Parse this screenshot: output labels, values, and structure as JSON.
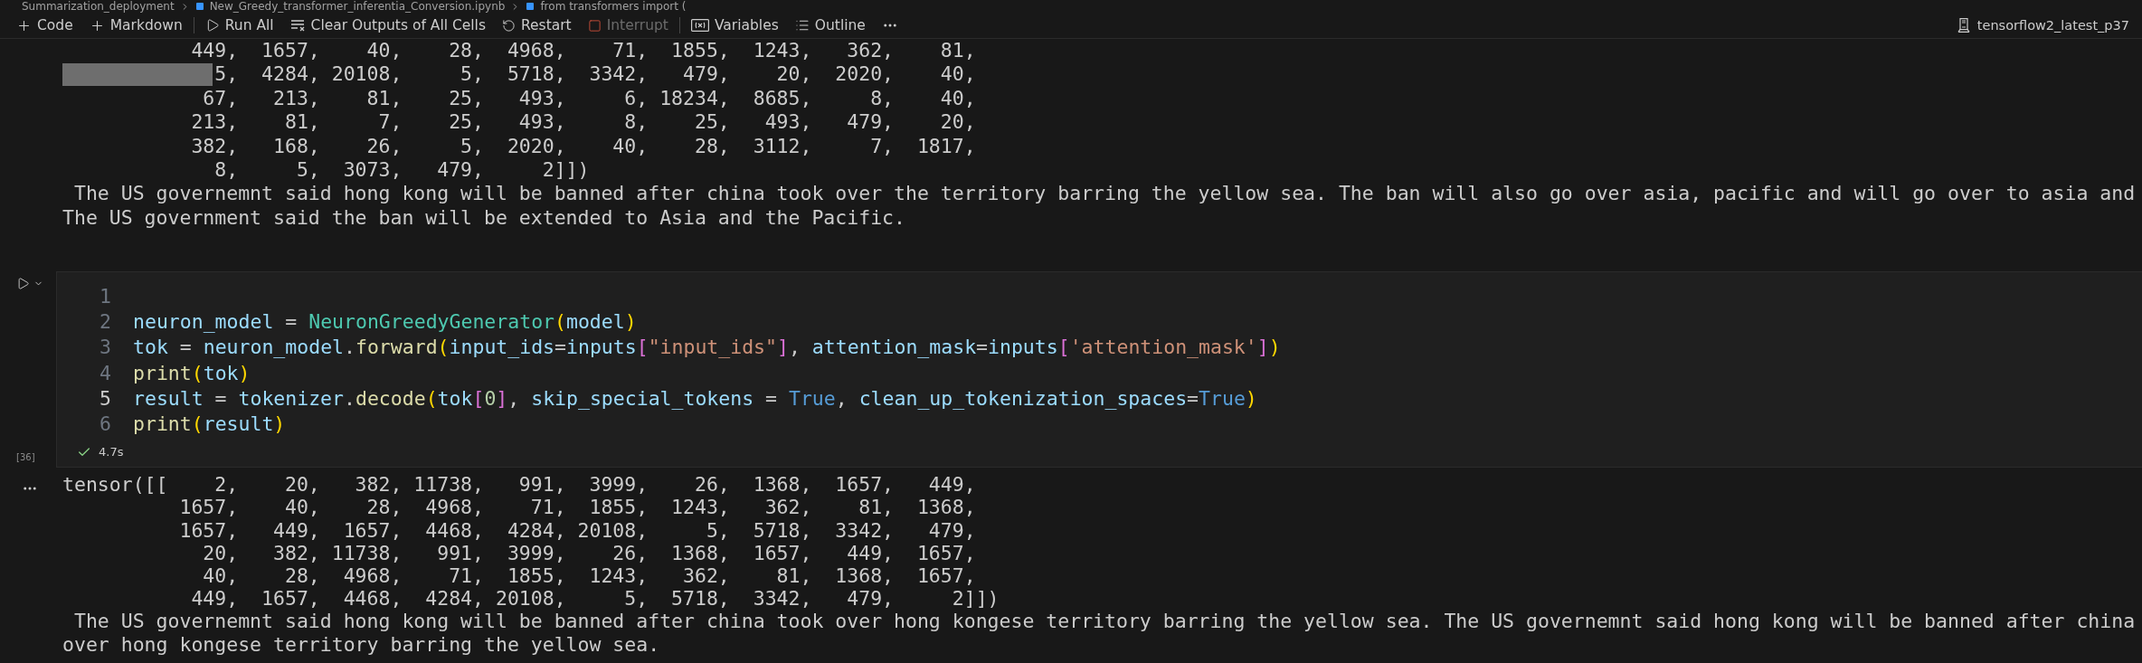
{
  "breadcrumb": [
    {
      "label": "Summarization_deployment",
      "kind": "folder"
    },
    {
      "label": "New_Greedy_transformer_inferentia_Conversion.ipynb",
      "kind": "notebook"
    },
    {
      "label": "from transformers import (",
      "kind": "symbol"
    }
  ],
  "toolbar": {
    "groups": [
      [
        {
          "label": "Code",
          "kind": "plus",
          "disabled": false
        },
        {
          "label": "Markdown",
          "kind": "plus",
          "disabled": false
        }
      ],
      [
        {
          "label": "Run All",
          "kind": "run",
          "disabled": false
        },
        {
          "label": "Clear Outputs of All Cells",
          "kind": "clear",
          "disabled": false
        },
        {
          "label": "Restart",
          "kind": "restart",
          "disabled": false
        },
        {
          "label": "Interrupt",
          "kind": "stop",
          "disabled": true
        }
      ],
      [
        {
          "label": "Variables",
          "kind": "variables",
          "disabled": false
        },
        {
          "label": "Outline",
          "kind": "outline",
          "disabled": false
        }
      ]
    ],
    "kernel": "tensorflow2_latest_p37"
  },
  "cells": [
    {
      "kind": "output",
      "has_menu": false,
      "lines": [
        {
          "text": "           449,  1657,    40,    28,  4968,    71,  1855,  1243,   362,    81,",
          "redacted": false
        },
        {
          "text": "             5,  4284, 20108,     5,  5718,  3342,   479,    20,  2020,    40,",
          "redacted": true
        },
        {
          "text": "            67,   213,    81,    25,   493,     6, 18234,  8685,     8,    40,",
          "redacted": false
        },
        {
          "text": "           213,    81,     7,    25,   493,     8,    25,   493,   479,    20,",
          "redacted": false
        },
        {
          "text": "           382,   168,    26,     5,  2020,    40,    28,  3112,     7,  1817,",
          "redacted": false
        },
        {
          "text": "             8,     5,  3073,   479,     2]])",
          "redacted": false
        },
        {
          "text": " The US governemnt said hong kong will be banned after china took over the territory barring the yellow sea. The ban will also go over asia, pacific and will go over to asia and",
          "redacted": false
        },
        {
          "text": "The US government said the ban will be extended to Asia and the Pacific.",
          "redacted": false
        }
      ]
    },
    {
      "kind": "code",
      "execution_count": "[36]",
      "succeeded": true,
      "duration": "4.7s",
      "lines": [
        {
          "number": "1",
          "current": false
        },
        {
          "number": "2",
          "current": false,
          "tokens": [
            {
              "t": "neuron_model",
              "kind": "var"
            },
            {
              "t": " = ",
              "kind": "op"
            },
            {
              "t": "NeuronGreedyGenerator",
              "kind": "class"
            },
            {
              "t": "(",
              "kind": "paren"
            },
            {
              "t": "model",
              "kind": "var"
            },
            {
              "t": ")",
              "kind": "paren"
            }
          ]
        },
        {
          "number": "3",
          "current": false,
          "tokens": [
            {
              "t": "tok",
              "kind": "var"
            },
            {
              "t": " = ",
              "kind": "op"
            },
            {
              "t": "neuron_model",
              "kind": "var"
            },
            {
              "t": ".",
              "kind": "op"
            },
            {
              "t": "forward",
              "kind": "fn"
            },
            {
              "t": "(",
              "kind": "paren"
            },
            {
              "t": "input_ids",
              "kind": "var"
            },
            {
              "t": "=",
              "kind": "op"
            },
            {
              "t": "inputs",
              "kind": "var"
            },
            {
              "t": "[",
              "kind": "bracket"
            },
            {
              "t": "\"input_ids\"",
              "kind": "str"
            },
            {
              "t": "]",
              "kind": "bracket"
            },
            {
              "t": ", ",
              "kind": "op"
            },
            {
              "t": "attention_mask",
              "kind": "var"
            },
            {
              "t": "=",
              "kind": "op"
            },
            {
              "t": "inputs",
              "kind": "var"
            },
            {
              "t": "[",
              "kind": "bracket"
            },
            {
              "t": "'attention_mask'",
              "kind": "str"
            },
            {
              "t": "]",
              "kind": "bracket"
            },
            {
              "t": ")",
              "kind": "paren"
            }
          ]
        },
        {
          "number": "4",
          "current": false,
          "tokens": [
            {
              "t": "print",
              "kind": "fn"
            },
            {
              "t": "(",
              "kind": "paren"
            },
            {
              "t": "tok",
              "kind": "var"
            },
            {
              "t": ")",
              "kind": "paren"
            }
          ]
        },
        {
          "number": "5",
          "current": true,
          "tokens": [
            {
              "t": "result",
              "kind": "var"
            },
            {
              "t": " = ",
              "kind": "op"
            },
            {
              "t": "tokenizer",
              "kind": "var"
            },
            {
              "t": ".",
              "kind": "op"
            },
            {
              "t": "decode",
              "kind": "fn"
            },
            {
              "t": "(",
              "kind": "paren"
            },
            {
              "t": "tok",
              "kind": "var"
            },
            {
              "t": "[",
              "kind": "bracket"
            },
            {
              "t": "0",
              "kind": "num"
            },
            {
              "t": "]",
              "kind": "bracket"
            },
            {
              "t": ", ",
              "kind": "op"
            },
            {
              "t": "skip_special_tokens",
              "kind": "var"
            },
            {
              "t": " = ",
              "kind": "op"
            },
            {
              "t": "True",
              "kind": "kw"
            },
            {
              "t": ", ",
              "kind": "op"
            },
            {
              "t": "clean_up_tokenization_spaces",
              "kind": "var"
            },
            {
              "t": "=",
              "kind": "op"
            },
            {
              "t": "True",
              "kind": "kw"
            },
            {
              "t": ")",
              "kind": "paren"
            }
          ]
        },
        {
          "number": "6",
          "current": false,
          "tokens": [
            {
              "t": "print",
              "kind": "fn"
            },
            {
              "t": "(",
              "kind": "paren"
            },
            {
              "t": "result",
              "kind": "var"
            },
            {
              "t": ")",
              "kind": "paren"
            }
          ]
        }
      ]
    },
    {
      "kind": "output",
      "has_menu": true,
      "lines": [
        {
          "text": "tensor([[    2,    20,   382, 11738,   991,  3999,    26,  1368,  1657,   449,",
          "redacted": false
        },
        {
          "text": "          1657,    40,    28,  4968,    71,  1855,  1243,   362,    81,  1368,",
          "redacted": false
        },
        {
          "text": "          1657,   449,  1657,  4468,  4284, 20108,     5,  5718,  3342,   479,",
          "redacted": false
        },
        {
          "text": "            20,   382, 11738,   991,  3999,    26,  1368,  1657,   449,  1657,",
          "redacted": false
        },
        {
          "text": "            40,    28,  4968,    71,  1855,  1243,   362,    81,  1368,  1657,",
          "redacted": false
        },
        {
          "text": "           449,  1657,  4468,  4284, 20108,     5,  5718,  3342,   479,     2]])",
          "redacted": false
        },
        {
          "text": " The US governemnt said hong kong will be banned after china took over hong kongese territory barring the yellow sea. The US governemnt said hong kong will be banned after china",
          "redacted": false
        },
        {
          "text": "over hong kongese territory barring the yellow sea.",
          "redacted": false
        }
      ]
    }
  ]
}
